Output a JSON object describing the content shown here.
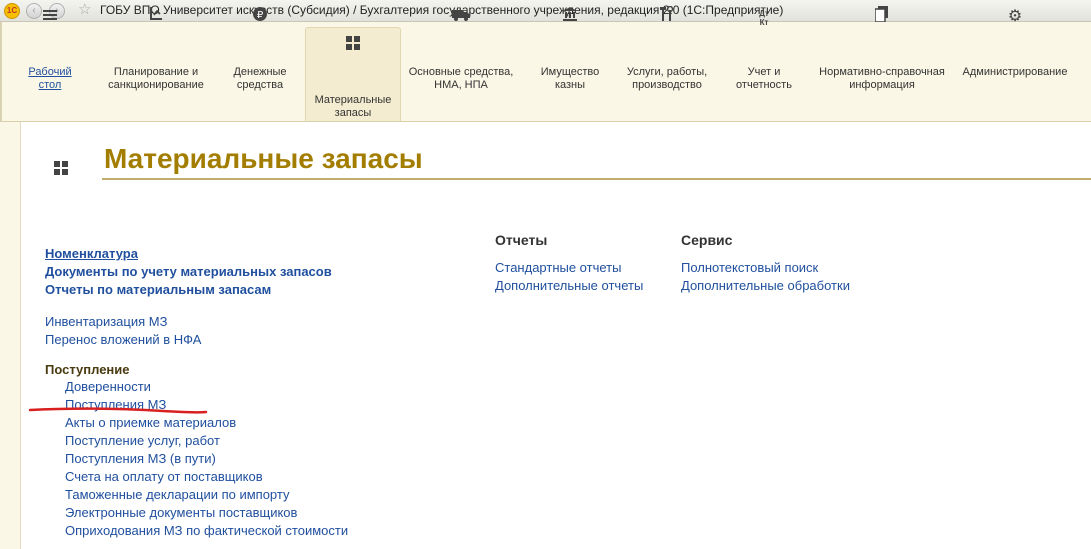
{
  "window": {
    "logo": "1С",
    "title": "ГОБУ ВПО Университет искусств (Субсидия) / Бухгалтерия государственного учреждения, редакция 2.0  (1С:Предприятие)"
  },
  "sections": [
    {
      "label": "Рабочий стол",
      "icon": "menu-lines-icon"
    },
    {
      "label": "Планирование и санкционирование",
      "icon": "planning-icon"
    },
    {
      "label": "Денежные средства",
      "icon": "ruble-icon"
    },
    {
      "label": "Материальные запасы",
      "icon": "grid-icon",
      "active": true
    },
    {
      "label": "Основные средства, НМА, НПА",
      "icon": "truck-icon"
    },
    {
      "label": "Имущество казны",
      "icon": "bank-icon"
    },
    {
      "label": "Услуги, работы, производство",
      "icon": "tools-icon"
    },
    {
      "label": "Учет и отчетность",
      "icon": "dt-kt-icon"
    },
    {
      "label": "Нормативно-справочная информация",
      "icon": "reference-book-icon"
    },
    {
      "label": "Администрирование",
      "icon": "gear-icon"
    }
  ],
  "page": {
    "title": "Материальные запасы"
  },
  "main_links": {
    "primary": [
      "Номенклатура",
      "Документы по учету материальных запасов",
      "Отчеты по материальным запасам"
    ],
    "secondary": [
      "Инвентаризация МЗ",
      "Перенос вложений в НФА"
    ],
    "group_title": "Поступление",
    "group_items": [
      "Доверенности",
      "Поступления МЗ",
      "Акты о приемке материалов",
      "Поступление услуг, работ",
      "Поступления МЗ (в пути)",
      "Счета на оплату от поставщиков",
      "Таможенные декларации по импорту",
      "Электронные документы поставщиков",
      "Оприходования МЗ по фактической стоимости"
    ]
  },
  "reports": {
    "title": "Отчеты",
    "items": [
      "Стандартные отчеты",
      "Дополнительные отчеты"
    ]
  },
  "service": {
    "title": "Сервис",
    "items": [
      "Полнотекстовый поиск",
      "Дополнительные обработки"
    ]
  },
  "colors": {
    "title": "#a37d00",
    "link": "#1f4f9e",
    "highlight_mark": "#d92020",
    "panel_bg": "#fbf7e6"
  }
}
